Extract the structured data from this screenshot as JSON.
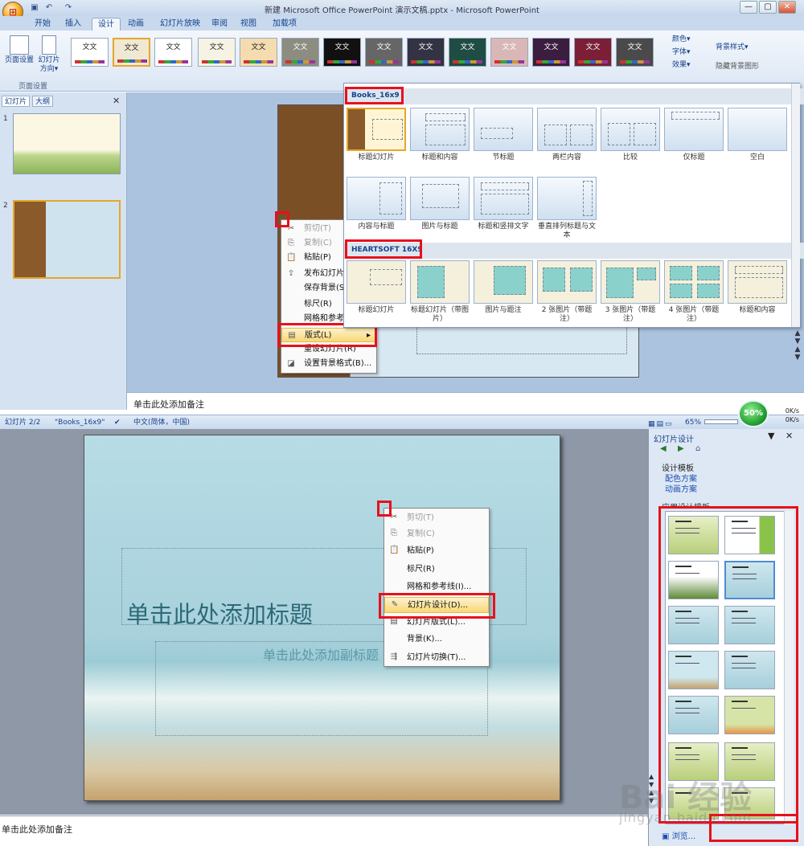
{
  "window": {
    "title": "新建 Microsoft Office PowerPoint 演示文稿.pptx - Microsoft PowerPoint",
    "min": "—",
    "max": "▢",
    "close": "✕"
  },
  "tabs": [
    "开始",
    "插入",
    "设计",
    "动画",
    "幻灯片放映",
    "审阅",
    "视图",
    "加载项"
  ],
  "ribbon": {
    "page_setup": "页面设置",
    "orientation": "幻灯片方向▾",
    "group_label": "页面设置",
    "theme_text": "文文",
    "colors": "颜色▾",
    "fonts": "字体▾",
    "effects": "效果▾",
    "bg_styles": "背景样式▾",
    "hide_bg": "隐藏背景图形"
  },
  "left_pane": {
    "tab_slides": "幻灯片",
    "tab_outline": "大纲",
    "close": "✕",
    "slide_numbers": [
      "1",
      "2"
    ]
  },
  "layout_menu": {
    "section1": "Books_16x9",
    "row1": [
      "标题幻灯片",
      "标题和内容",
      "节标题",
      "两栏内容",
      "比较",
      "仅标题",
      "空白"
    ],
    "row2": [
      "内容与标题",
      "图片与标题",
      "标题和竖排文字",
      "垂直排列标题与文本"
    ],
    "section2": "HEARTSOFT 16X9",
    "row3": [
      "标题幻灯片",
      "标题幻灯片（带图片）",
      "图片与题注",
      "2 张图片（带题注）",
      "3 张图片（带题注）",
      "4 张图片（带题注）",
      "标题和内容"
    ]
  },
  "context_menu_top": {
    "items": [
      "剪切(T)",
      "复制(C)",
      "粘贴(P)",
      "发布幻灯片(S)...",
      "保存背景(S)...",
      "标尺(R)",
      "网格和参考线",
      "版式(L)",
      "重设幻灯片(R)",
      "设置背景格式(B)..."
    ],
    "submenu_arrow": "▸"
  },
  "notes_top": "单击此处添加备注",
  "status_bar": {
    "slide": "幻灯片 2/2",
    "theme": "\"Books_16x9\"",
    "language": "中文(简体，中国)",
    "zoom": "65%",
    "net_percent": "50%",
    "up_speed": "0K/s",
    "down_speed": "0K/s"
  },
  "slide": {
    "title_placeholder": "单击此处添加标题",
    "subtitle_placeholder": "单击此处添加副标题"
  },
  "context_menu_bottom": {
    "items": [
      "剪切(T)",
      "复制(C)",
      "粘贴(P)",
      "标尺(R)",
      "网格和参考线(I)...",
      "幻灯片设计(D)...",
      "幻灯片版式(L)...",
      "背景(K)...",
      "幻灯片切换(T)..."
    ]
  },
  "task_pane": {
    "title": "幻灯片设计",
    "links": [
      "设计模板",
      "配色方案",
      "动画方案"
    ],
    "apply_label": "应用设计模板",
    "browse": "浏览...",
    "thumb_label": "Lorem Ipsum"
  },
  "notes_bottom": "单击此处添加备注",
  "watermark": {
    "main": "Bai  经验",
    "sub": "jingyan.baidu.com"
  },
  "colors": {
    "highlight": "#e8101c",
    "ribbon": "#dbe6f4",
    "accent": "#15428b"
  }
}
